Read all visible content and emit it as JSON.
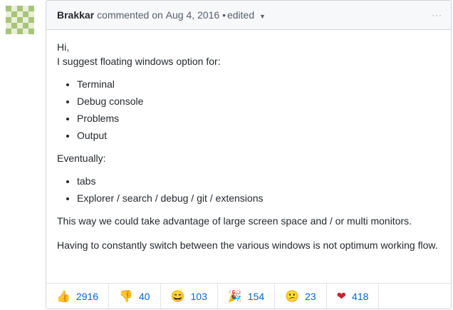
{
  "comment": {
    "author": "Brakkar",
    "action": "commented on",
    "date": "Aug 4, 2016",
    "separator": "•",
    "edited_label": "edited",
    "more": "···",
    "greeting": "Hi,",
    "intro": "I suggest floating windows option for:",
    "list1": [
      "Terminal",
      "Debug console",
      "Problems",
      "Output"
    ],
    "eventually": "Eventually:",
    "list2": [
      "tabs",
      "Explorer / search / debug / git / extensions"
    ],
    "para1": "This way we could take advantage of large screen space and / or multi monitors.",
    "para2": "Having to constantly switch between the various windows is not optimum working flow."
  },
  "reactions": [
    {
      "icon": "thumbs-up-icon",
      "glyph": "👍",
      "count": "2916"
    },
    {
      "icon": "thumbs-down-icon",
      "glyph": "👎",
      "count": "40"
    },
    {
      "icon": "laugh-icon",
      "glyph": "😄",
      "count": "103"
    },
    {
      "icon": "hooray-icon",
      "glyph": "🎉",
      "count": "154"
    },
    {
      "icon": "confused-icon",
      "glyph": "😕",
      "count": "23"
    },
    {
      "icon": "heart-icon",
      "glyph": "❤",
      "count": "418"
    }
  ],
  "colors": {
    "link": "#0366d6",
    "header_bg": "#f6f8fa",
    "border": "#d1d5da",
    "avatar_light": "#e8f0d8",
    "avatar_dark": "#a9c37a"
  }
}
